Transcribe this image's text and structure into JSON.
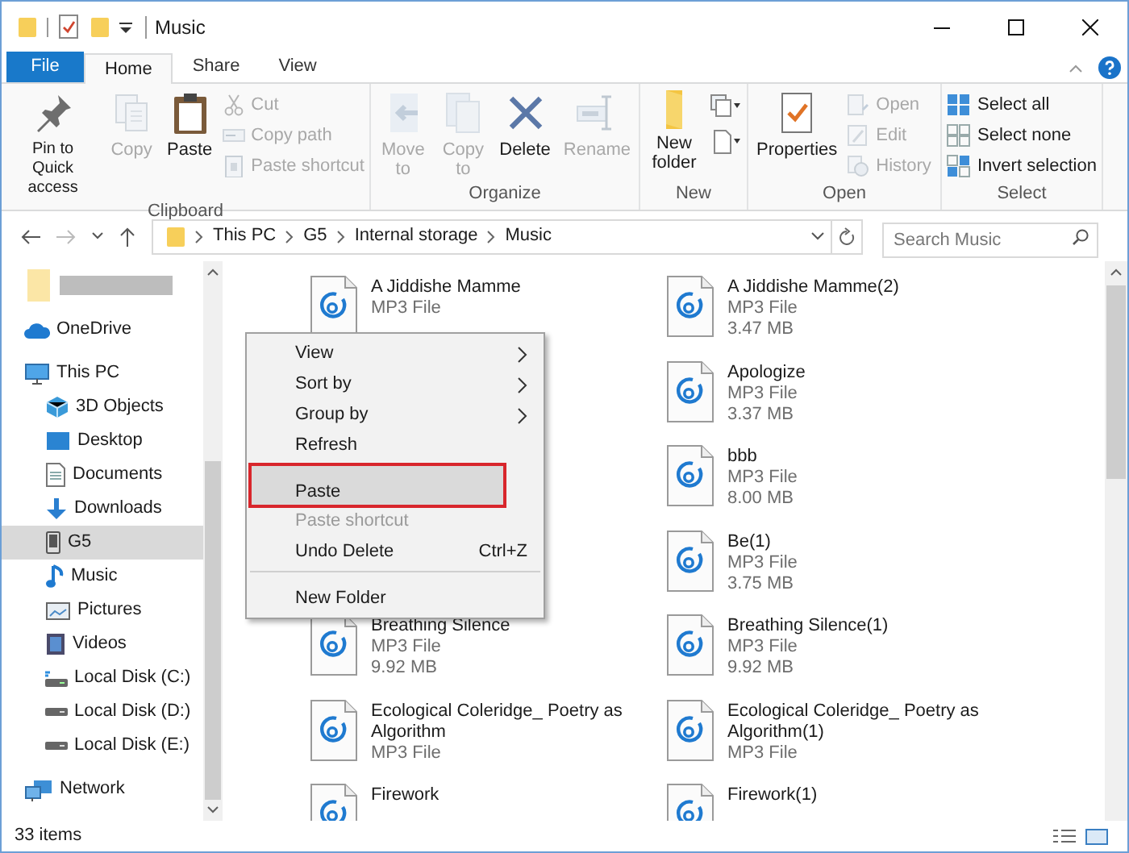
{
  "window": {
    "title": "Music"
  },
  "ribbon_tabs": [
    {
      "label": "File",
      "kind": "file",
      "selected": false
    },
    {
      "label": "Home",
      "kind": "tab",
      "selected": true
    },
    {
      "label": "Share",
      "kind": "tab",
      "selected": false
    },
    {
      "label": "View",
      "kind": "tab",
      "selected": false
    }
  ],
  "ribbon_groups": [
    {
      "label": "Clipboard",
      "items": [
        {
          "label": "Pin to Quick access",
          "kind": "large",
          "disabled": false
        },
        {
          "label": "Copy",
          "kind": "large",
          "disabled": true
        },
        {
          "label": "Paste",
          "kind": "large",
          "disabled": false
        },
        {
          "label": "Cut",
          "kind": "small",
          "disabled": true
        },
        {
          "label": "Copy path",
          "kind": "small",
          "disabled": true
        },
        {
          "label": "Paste shortcut",
          "kind": "small",
          "disabled": true
        }
      ]
    },
    {
      "label": "Organize",
      "items": [
        {
          "label": "Move to",
          "kind": "large",
          "disabled": true
        },
        {
          "label": "Copy to",
          "kind": "large",
          "disabled": true
        },
        {
          "label": "Delete",
          "kind": "large",
          "disabled": false
        },
        {
          "label": "Rename",
          "kind": "large",
          "disabled": true
        }
      ]
    },
    {
      "label": "New",
      "items": [
        {
          "label": "New folder",
          "kind": "large",
          "disabled": false
        },
        {
          "kind": "icons"
        }
      ]
    },
    {
      "label": "Open",
      "items": [
        {
          "label": "Properties",
          "kind": "large",
          "disabled": false
        },
        {
          "label": "Open",
          "kind": "small",
          "disabled": true
        },
        {
          "label": "Edit",
          "kind": "small",
          "disabled": true
        },
        {
          "label": "History",
          "kind": "small",
          "disabled": true
        }
      ]
    },
    {
      "label": "Select",
      "items": [
        {
          "label": "Select all",
          "kind": "small",
          "disabled": false
        },
        {
          "label": "Select none",
          "kind": "small",
          "disabled": false
        },
        {
          "label": "Invert selection",
          "kind": "small",
          "disabled": false
        }
      ]
    }
  ],
  "address_bar": {
    "segments": [
      "This PC",
      "G5",
      "Internal storage",
      "Music"
    ]
  },
  "search": {
    "placeholder": "Search Music"
  },
  "sidebar": {
    "items": [
      {
        "label": "OneDrive",
        "selected": false
      },
      {
        "label": "This PC",
        "selected": false,
        "children": [
          {
            "label": "3D Objects",
            "selected": false
          },
          {
            "label": "Desktop",
            "selected": false
          },
          {
            "label": "Documents",
            "selected": false
          },
          {
            "label": "Downloads",
            "selected": false
          },
          {
            "label": "G5",
            "selected": true
          },
          {
            "label": "Music",
            "selected": false
          },
          {
            "label": "Pictures",
            "selected": false
          },
          {
            "label": "Videos",
            "selected": false
          },
          {
            "label": "Local Disk (C:)",
            "selected": false
          },
          {
            "label": "Local Disk (D:)",
            "selected": false
          },
          {
            "label": "Local Disk (E:)",
            "selected": false
          }
        ]
      },
      {
        "label": "Network",
        "selected": false
      }
    ]
  },
  "files": {
    "column_1": [
      {
        "name": "A Jiddishe Mamme",
        "type": "MP3 File"
      },
      {
        "name": "Breathing Silence",
        "type": "MP3 File",
        "size": "9.92 MB"
      },
      {
        "name": "Ecological Coleridge_ Poetry as Algorithm",
        "type": "MP3 File"
      },
      {
        "name": "Firework"
      }
    ],
    "column_2": [
      {
        "name": "A Jiddishe Mamme(2)",
        "type": "MP3 File",
        "size": "3.47 MB"
      },
      {
        "name": "Apologize",
        "type": "MP3 File",
        "size": "3.37 MB"
      },
      {
        "name": "bbb",
        "type": "MP3 File",
        "size": "8.00 MB"
      },
      {
        "name": "Be(1)",
        "type": "MP3 File",
        "size": "3.75 MB"
      },
      {
        "name": "Breathing Silence(1)",
        "type": "MP3 File",
        "size": "9.92 MB"
      },
      {
        "name": "Ecological Coleridge_ Poetry as Algorithm(1)",
        "type": "MP3 File"
      },
      {
        "name": "Firework(1)"
      }
    ]
  },
  "context_menu": {
    "items": [
      {
        "label": "View",
        "submenu": true,
        "disabled": false,
        "selected": false,
        "separator_before": false
      },
      {
        "label": "Sort by",
        "submenu": true,
        "disabled": false,
        "selected": false,
        "separator_before": false
      },
      {
        "label": "Group by",
        "submenu": true,
        "disabled": false,
        "selected": false,
        "separator_before": false
      },
      {
        "label": "Refresh",
        "submenu": false,
        "disabled": false,
        "selected": false,
        "separator_before": false
      },
      {
        "label": "Paste",
        "submenu": false,
        "disabled": false,
        "selected": true,
        "separator_before": true
      },
      {
        "label": "Paste shortcut",
        "submenu": false,
        "disabled": true,
        "selected": false,
        "separator_before": false
      },
      {
        "label": "Undo Delete",
        "shortcut": "Ctrl+Z",
        "submenu": false,
        "disabled": false,
        "selected": false,
        "separator_before": false
      },
      {
        "label": "New Folder",
        "submenu": false,
        "disabled": false,
        "selected": false,
        "separator_before": true
      }
    ]
  },
  "status_bar": {
    "item_count": "33 items"
  }
}
